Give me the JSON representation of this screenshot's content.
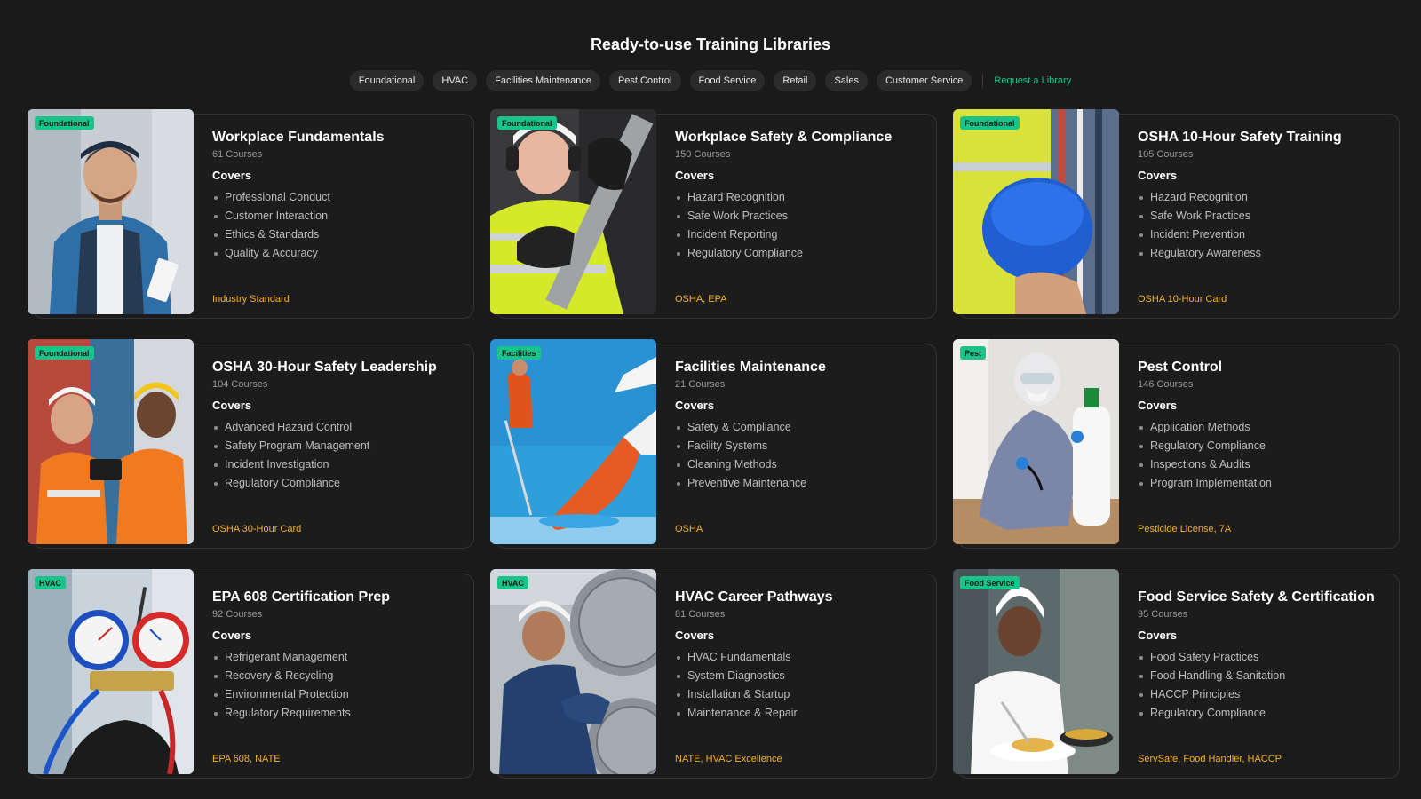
{
  "page": {
    "title": "Ready-to-use Training Libraries"
  },
  "filters": {
    "chips": [
      "Foundational",
      "HVAC",
      "Facilities Maintenance",
      "Pest Control",
      "Food Service",
      "Retail",
      "Sales",
      "Customer Service"
    ],
    "request_link": "Request a Library"
  },
  "colors": {
    "accent_green": "#19c48a",
    "cert_gold": "#f2b01e",
    "background": "#1a1a1b"
  },
  "cards": [
    {
      "tag": "Foundational",
      "title": "Workplace Fundamentals",
      "courses": "61 Courses",
      "covers_label": "Covers",
      "topics": [
        "Professional Conduct",
        "Customer Interaction",
        "Ethics & Standards",
        "Quality & Accuracy"
      ],
      "cert": "Industry Standard",
      "image": "worker-with-clipboard-photo"
    },
    {
      "tag": "Foundational",
      "title": "Workplace Safety & Compliance",
      "courses": "150 Courses",
      "covers_label": "Covers",
      "topics": [
        "Hazard Recognition",
        "Safe Work Practices",
        "Incident Reporting",
        "Regulatory Compliance"
      ],
      "cert": "OSHA, EPA",
      "image": "safety-worker-with-pipe-photo"
    },
    {
      "tag": "Foundational",
      "title": "OSHA 10-Hour Safety Training",
      "courses": "105 Courses",
      "covers_label": "Covers",
      "topics": [
        "Hazard Recognition",
        "Safe Work Practices",
        "Incident Prevention",
        "Regulatory Awareness"
      ],
      "cert": "OSHA 10-Hour Card",
      "image": "hard-hat-vest-photo"
    },
    {
      "tag": "Foundational",
      "title": "OSHA 30-Hour Safety Leadership",
      "courses": "104 Courses",
      "covers_label": "Covers",
      "topics": [
        "Advanced Hazard Control",
        "Safety Program Management",
        "Incident Investigation",
        "Regulatory Compliance"
      ],
      "cert": "OSHA 30-Hour Card",
      "image": "site-supervisors-photo"
    },
    {
      "tag": "Facilities",
      "title": "Facilities Maintenance",
      "courses": "21 Courses",
      "covers_label": "Covers",
      "topics": [
        "Safety & Compliance",
        "Facility Systems",
        "Cleaning Methods",
        "Preventive Maintenance"
      ],
      "cert": "OSHA",
      "image": "gloved-hand-cleaning-photo"
    },
    {
      "tag": "Pest",
      "title": "Pest Control",
      "courses": "146 Courses",
      "covers_label": "Covers",
      "topics": [
        "Application Methods",
        "Regulatory Compliance",
        "Inspections & Audits",
        "Program Implementation"
      ],
      "cert": "Pesticide License, 7A",
      "image": "pest-technician-sprayer-photo"
    },
    {
      "tag": "HVAC",
      "title": "EPA 608 Certification Prep",
      "courses": "92 Courses",
      "covers_label": "Covers",
      "topics": [
        "Refrigerant Management",
        "Recovery & Recycling",
        "Environmental Protection",
        "Regulatory Requirements"
      ],
      "cert": "EPA 608, NATE",
      "image": "manifold-gauges-photo"
    },
    {
      "tag": "HVAC",
      "title": "HVAC Career Pathways",
      "courses": "81 Courses",
      "covers_label": "Covers",
      "topics": [
        "HVAC Fundamentals",
        "System Diagnostics",
        "Installation & Startup",
        "Maintenance & Repair"
      ],
      "cert": "NATE, HVAC Excellence",
      "image": "hvac-technician-unit-photo"
    },
    {
      "tag": "Food Service",
      "title": "Food Service Safety & Certification",
      "courses": "95 Courses",
      "covers_label": "Covers",
      "topics": [
        "Food Safety Practices",
        "Food Handling & Sanitation",
        "HACCP Principles",
        "Regulatory Compliance"
      ],
      "cert": "ServSafe, Food Handler, HACCP",
      "image": "chef-plating-photo"
    }
  ]
}
